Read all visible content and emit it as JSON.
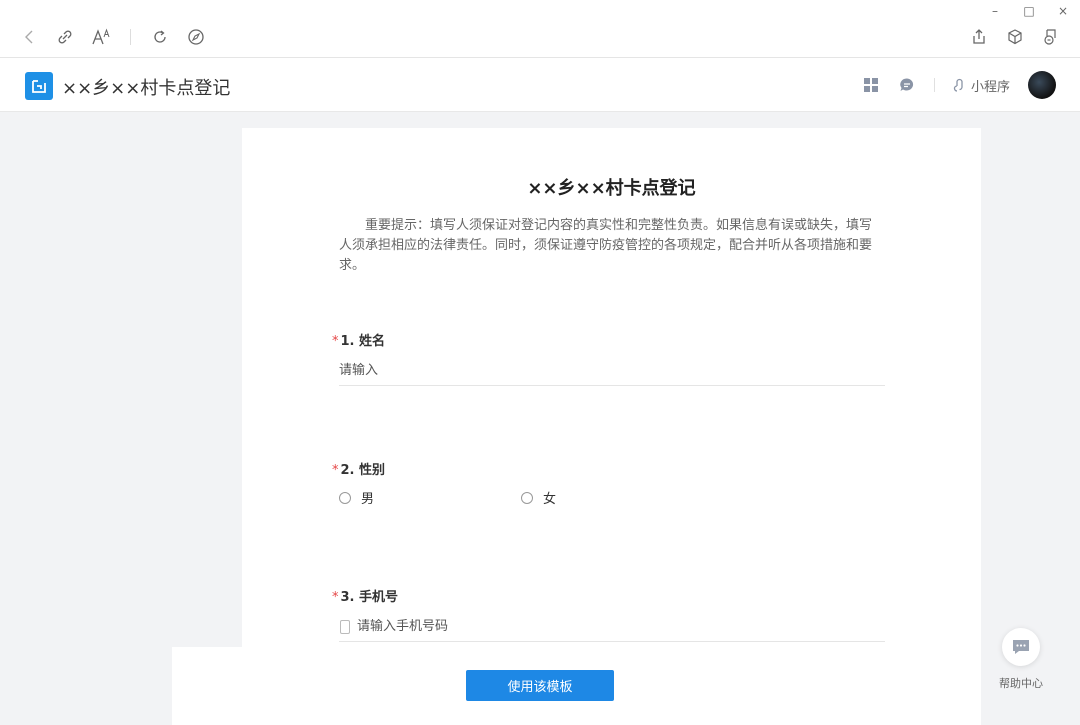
{
  "browser": {
    "window_controls": [
      "–",
      "□",
      "×"
    ]
  },
  "app": {
    "title": "××乡××村卡点登记",
    "mini_program_label": "小程序",
    "accent_color": "#1e88e5"
  },
  "form": {
    "title": "××乡××村卡点登记",
    "notice": "重要提示：填写人须保证对登记内容的真实性和完整性负责。如果信息有误或缺失，填写人须承担相应的法律责任。同时，须保证遵守防疫管控的各项规定，配合并听从各项措施和要求。",
    "required_mark": "*",
    "q1": {
      "label": "1.  姓名",
      "placeholder": "请输入"
    },
    "q2": {
      "label": "2.  性别",
      "options": [
        "男",
        "女"
      ]
    },
    "q3": {
      "label": "3.  手机号",
      "placeholder": "请输入手机号码"
    }
  },
  "actions": {
    "use_template": "使用该模板"
  },
  "help": {
    "label": "帮助中心"
  }
}
